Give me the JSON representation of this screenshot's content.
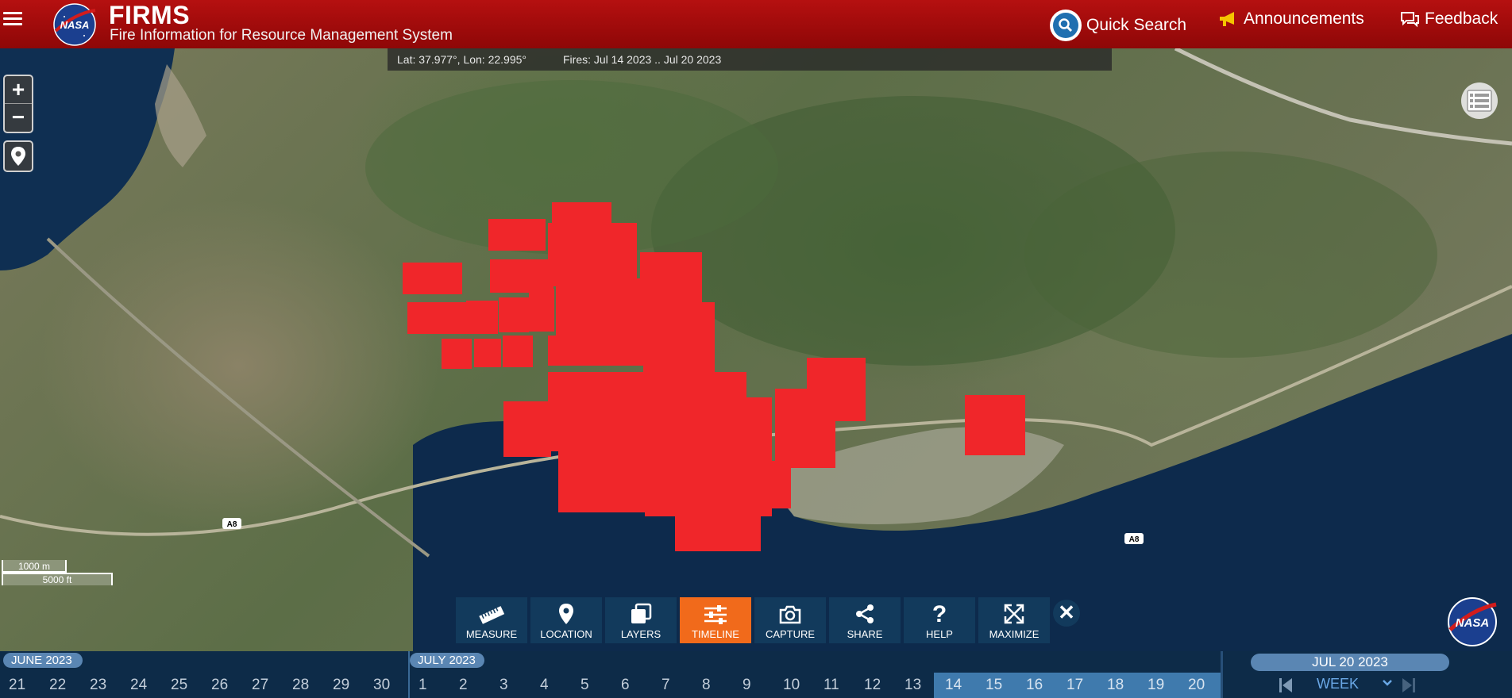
{
  "header": {
    "title": "FIRMS",
    "subtitle": "Fire Information for Resource Management System",
    "quick_search": "Quick Search",
    "announcements": "Announcements",
    "feedback": "Feedback"
  },
  "map": {
    "coordinates": "Lat: 37.977°, Lon: 22.995°",
    "fires_range": "Fires: Jul 14 2023 .. Jul 20 2023",
    "zoom_in": "+",
    "zoom_out": "−",
    "scale_metric": "1000 m",
    "scale_imperial": "5000 ft",
    "road_labels": [
      "A8",
      "A8",
      "A8"
    ]
  },
  "toolbar": {
    "items": [
      {
        "label": "MEASURE",
        "icon": "ruler-icon"
      },
      {
        "label": "LOCATION",
        "icon": "map-pin-icon"
      },
      {
        "label": "LAYERS",
        "icon": "layers-icon"
      },
      {
        "label": "TIMELINE",
        "icon": "sliders-icon",
        "active": true
      },
      {
        "label": "CAPTURE",
        "icon": "camera-icon"
      },
      {
        "label": "SHARE",
        "icon": "share-icon"
      },
      {
        "label": "HELP",
        "icon": "question-icon"
      },
      {
        "label": "MAXIMIZE",
        "icon": "expand-icon"
      }
    ],
    "close": "✕"
  },
  "timeline": {
    "month_june": "JUNE 2023",
    "month_july": "JULY 2023",
    "days": [
      "21",
      "22",
      "23",
      "24",
      "25",
      "26",
      "27",
      "28",
      "29",
      "30",
      "1",
      "2",
      "3",
      "4",
      "5",
      "6",
      "7",
      "8",
      "9",
      "10",
      "11",
      "12",
      "13",
      "14",
      "15",
      "16",
      "17",
      "18",
      "19",
      "20"
    ],
    "current_date": "JUL 20 2023",
    "interval": "WEEK"
  },
  "colors": {
    "header": "#a30c0c",
    "fire": "#f0262a",
    "toolbar": "#123a5c",
    "toolbar_active": "#f16a1b",
    "timeline": "#0d2b48"
  }
}
